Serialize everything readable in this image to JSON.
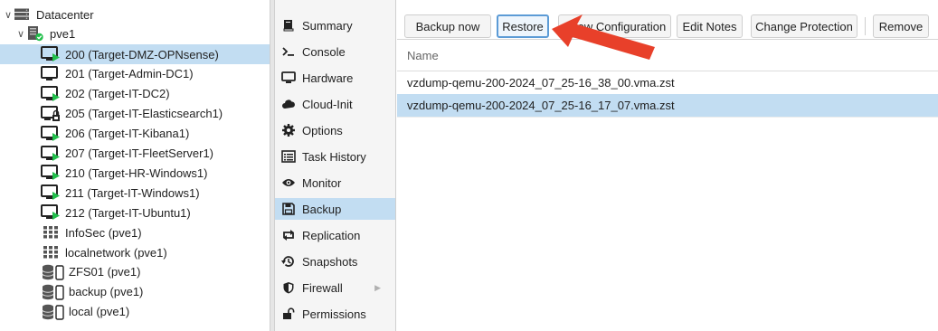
{
  "tree": {
    "datacenter": "Datacenter",
    "node": "pve1",
    "items": [
      {
        "label": "200 (Target-DMZ-OPNsense)",
        "icon": "vm-running-icon",
        "selected": true
      },
      {
        "label": "201 (Target-Admin-DC1)",
        "icon": "vm-stopped-icon"
      },
      {
        "label": "202 (Target-IT-DC2)",
        "icon": "vm-running-icon"
      },
      {
        "label": "205 (Target-IT-Elasticsearch1)",
        "icon": "vm-locked-icon"
      },
      {
        "label": "206 (Target-IT-Kibana1)",
        "icon": "vm-running-icon"
      },
      {
        "label": "207 (Target-IT-FleetServer1)",
        "icon": "vm-running-icon"
      },
      {
        "label": "210 (Target-HR-Windows1)",
        "icon": "vm-running-icon"
      },
      {
        "label": "211 (Target-IT-Windows1)",
        "icon": "vm-running-icon"
      },
      {
        "label": "212 (Target-IT-Ubuntu1)",
        "icon": "vm-running-icon"
      },
      {
        "label": "InfoSec (pve1)",
        "icon": "sdn-zone-icon"
      },
      {
        "label": "localnetwork (pve1)",
        "icon": "sdn-zone-icon"
      },
      {
        "label": "ZFS01 (pve1)",
        "icon": "storage-icon"
      },
      {
        "label": "backup (pve1)",
        "icon": "storage-icon"
      },
      {
        "label": "local (pve1)",
        "icon": "storage-icon"
      }
    ]
  },
  "nav": {
    "items": [
      {
        "label": "Summary",
        "icon": "book-icon"
      },
      {
        "label": "Console",
        "icon": "terminal-icon"
      },
      {
        "label": "Hardware",
        "icon": "monitor-icon"
      },
      {
        "label": "Cloud-Init",
        "icon": "cloud-icon"
      },
      {
        "label": "Options",
        "icon": "gear-icon"
      },
      {
        "label": "Task History",
        "icon": "list-icon"
      },
      {
        "label": "Monitor",
        "icon": "eye-icon"
      },
      {
        "label": "Backup",
        "icon": "floppy-icon",
        "active": true
      },
      {
        "label": "Replication",
        "icon": "retweet-icon"
      },
      {
        "label": "Snapshots",
        "icon": "history-icon"
      },
      {
        "label": "Firewall",
        "icon": "shield-icon",
        "submenu": true
      },
      {
        "label": "Permissions",
        "icon": "unlock-icon"
      }
    ]
  },
  "toolbar": {
    "backup_now": "Backup now",
    "restore": "Restore",
    "show_config": "Show Configuration",
    "edit_notes": "Edit Notes",
    "change_protection": "Change Protection",
    "remove": "Remove"
  },
  "grid": {
    "column_name": "Name",
    "rows": [
      {
        "name": "vzdump-qemu-200-2024_07_25-16_38_00.vma.zst"
      },
      {
        "name": "vzdump-qemu-200-2024_07_25-16_17_07.vma.zst",
        "selected": true
      }
    ]
  },
  "colors": {
    "selection": "#c2ddf2",
    "annotation_arrow": "#e8402a",
    "running_badge": "#21bf4b"
  }
}
